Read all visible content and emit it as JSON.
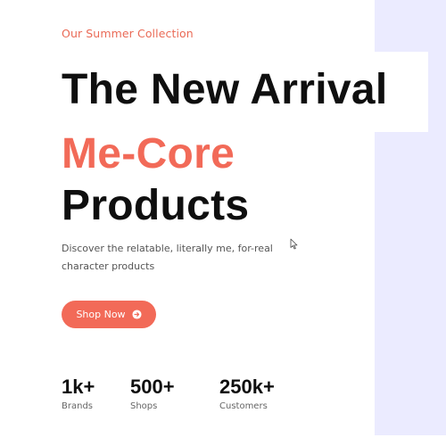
{
  "hero": {
    "tagline": "Our Summer Collection",
    "headline_line1": "The New Arrival",
    "headline_line2": "Me-Core",
    "headline_line3": "Products",
    "description": "Discover the relatable, literally me, for-real character products"
  },
  "cta": {
    "label": "Shop Now",
    "icon": "arrow-right-circle-icon"
  },
  "stats": [
    {
      "value": "1k+",
      "label": "Brands"
    },
    {
      "value": "500+",
      "label": "Shops"
    },
    {
      "value": "250k+",
      "label": "Customers"
    }
  ],
  "colors": {
    "accent": "#f26a58",
    "text": "#0f0f0f",
    "muted": "#555555",
    "side_panel": "#ebebff",
    "background": "#ffffff"
  }
}
